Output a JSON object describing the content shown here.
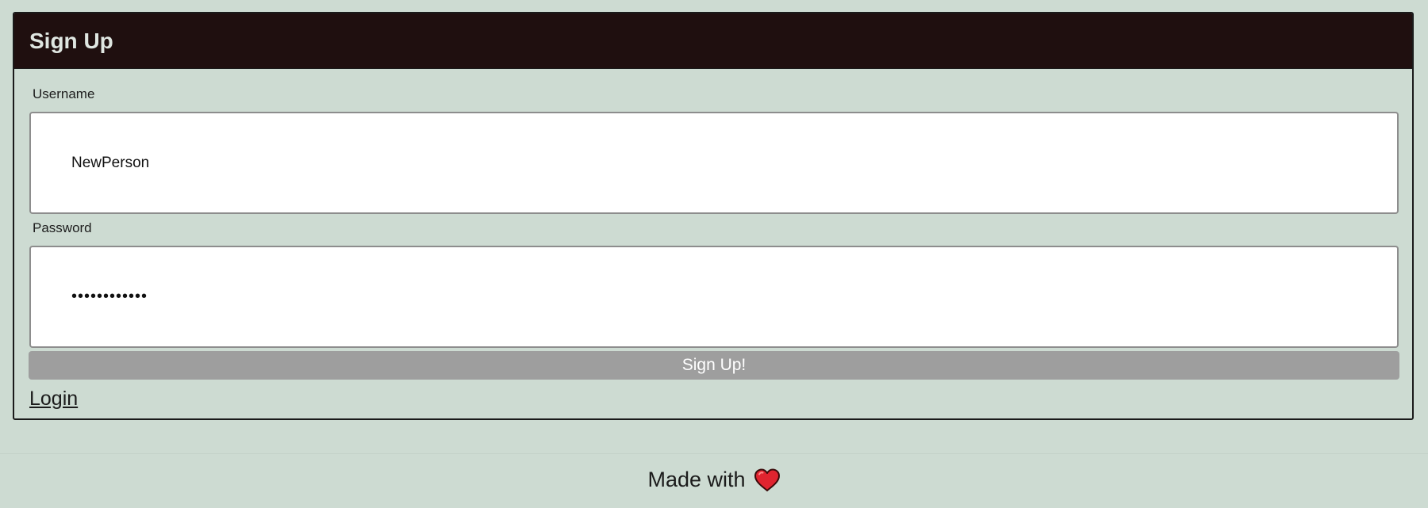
{
  "signup_form": {
    "title": "Sign Up",
    "username": {
      "label": "Username",
      "value": "NewPerson"
    },
    "password": {
      "label": "Password",
      "value": "passwordxyz1"
    },
    "submit_label": "Sign Up!",
    "login_link_label": "Login"
  },
  "footer": {
    "text": "Made with",
    "icon": "heart-icon"
  },
  "colors": {
    "page_background": "#cddbd2",
    "header_background": "#1f0f0f",
    "button_background": "#9e9e9e",
    "heart": "#e0242f"
  }
}
